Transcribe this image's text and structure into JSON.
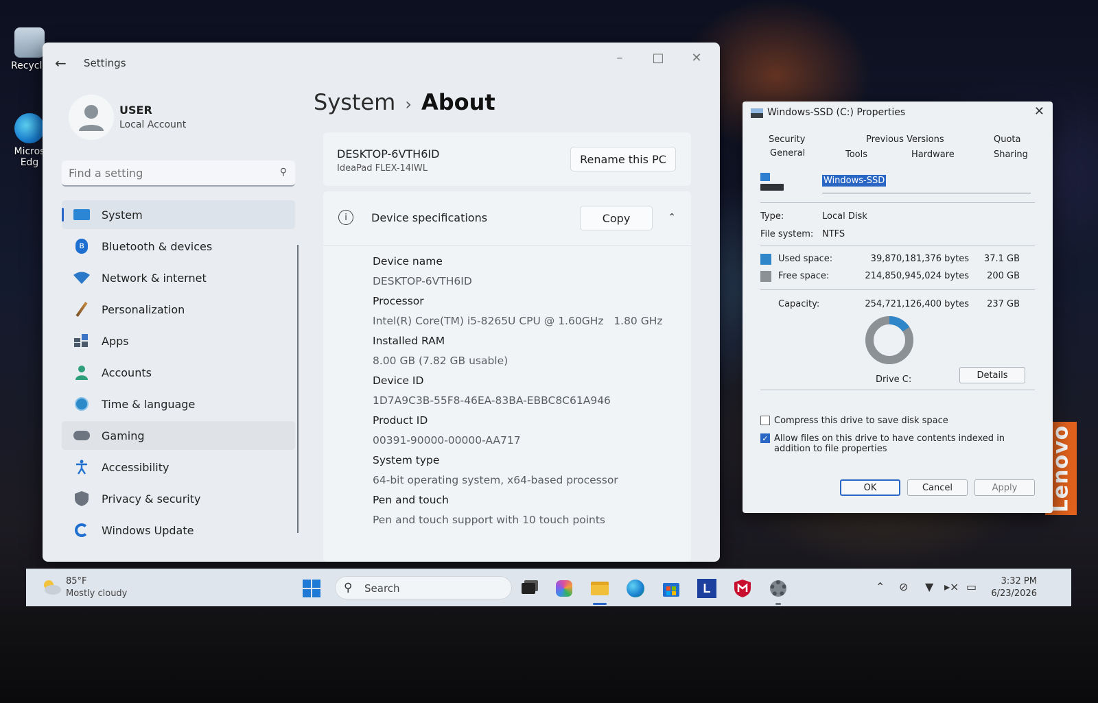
{
  "desktop": {
    "icons": [
      {
        "label": "Recycle"
      },
      {
        "label": "Micros Edg"
      }
    ],
    "brand": "Lenovo"
  },
  "settings": {
    "app_title": "Settings",
    "user": {
      "name": "USER",
      "account_type": "Local Account"
    },
    "search": {
      "placeholder": "Find a setting"
    },
    "nav": [
      {
        "label": "System",
        "icon": "system-icon",
        "active": true
      },
      {
        "label": "Bluetooth & devices",
        "icon": "bluetooth-icon"
      },
      {
        "label": "Network & internet",
        "icon": "wifi-icon"
      },
      {
        "label": "Personalization",
        "icon": "brush-icon"
      },
      {
        "label": "Apps",
        "icon": "apps-icon"
      },
      {
        "label": "Accounts",
        "icon": "account-icon"
      },
      {
        "label": "Time & language",
        "icon": "clock-globe-icon"
      },
      {
        "label": "Gaming",
        "icon": "gamepad-icon"
      },
      {
        "label": "Accessibility",
        "icon": "accessibility-icon"
      },
      {
        "label": "Privacy & security",
        "icon": "shield-icon"
      },
      {
        "label": "Windows Update",
        "icon": "update-icon"
      }
    ],
    "breadcrumb": {
      "parent": "System",
      "current": "About"
    },
    "pc_card": {
      "name": "DESKTOP-6VTH6ID",
      "model": "IdeaPad FLEX-14IWL",
      "rename_label": "Rename this PC"
    },
    "specs": {
      "title": "Device specifications",
      "copy_label": "Copy",
      "items": [
        {
          "label": "Device name",
          "value": "DESKTOP-6VTH6ID"
        },
        {
          "label": "Processor",
          "value": "Intel(R) Core(TM) i5-8265U CPU @ 1.60GHz   1.80 GHz"
        },
        {
          "label": "Installed RAM",
          "value": "8.00 GB (7.82 GB usable)"
        },
        {
          "label": "Device ID",
          "value": "1D7A9C3B-55F8-46EA-83BA-EBBC8C61A946"
        },
        {
          "label": "Product ID",
          "value": "00391-90000-00000-AA717"
        },
        {
          "label": "System type",
          "value": "64-bit operating system, x64-based processor"
        },
        {
          "label": "Pen and touch",
          "value": "Pen and touch support with 10 touch points"
        }
      ]
    }
  },
  "properties": {
    "title": "Windows-SSD (C:) Properties",
    "tabs_row1": [
      "Security",
      "Previous Versions",
      "Quota"
    ],
    "tabs_row2": [
      "General",
      "Tools",
      "Hardware",
      "Sharing"
    ],
    "active_tab": "General",
    "drive_label": "Windows-SSD",
    "type_label": "Type:",
    "type_value": "Local Disk",
    "fs_label": "File system:",
    "fs_value": "NTFS",
    "used": {
      "label": "Used space:",
      "bytes": "39,870,181,376 bytes",
      "size": "37.1 GB",
      "color": "#2f86c9"
    },
    "free": {
      "label": "Free space:",
      "bytes": "214,850,945,024 bytes",
      "size": "200 GB",
      "color": "#8c9196"
    },
    "capacity": {
      "label": "Capacity:",
      "bytes": "254,721,126,400 bytes",
      "size": "237 GB"
    },
    "used_fraction": 0.157,
    "drive_caption": "Drive C:",
    "details_label": "Details",
    "compress_label": "Compress this drive to save disk space",
    "compress_checked": false,
    "index_label": "Allow files on this drive to have contents indexed in addition to file properties",
    "index_checked": true,
    "ok_label": "OK",
    "cancel_label": "Cancel",
    "apply_label": "Apply"
  },
  "taskbar": {
    "weather_temp": "85°F",
    "weather_cond": "Mostly cloudy",
    "search_label": "Search",
    "apps": [
      "start-icon",
      "task-view-icon",
      "copilot-icon",
      "file-explorer-icon",
      "edge-icon",
      "store-icon",
      "lenovo-l-icon",
      "mcafee-icon",
      "settings-gear-icon"
    ],
    "time": "3:32 PM",
    "date": "6/23/2026"
  },
  "colors": {
    "accent": "#2a68c8",
    "lenovo": "#e2621d"
  }
}
